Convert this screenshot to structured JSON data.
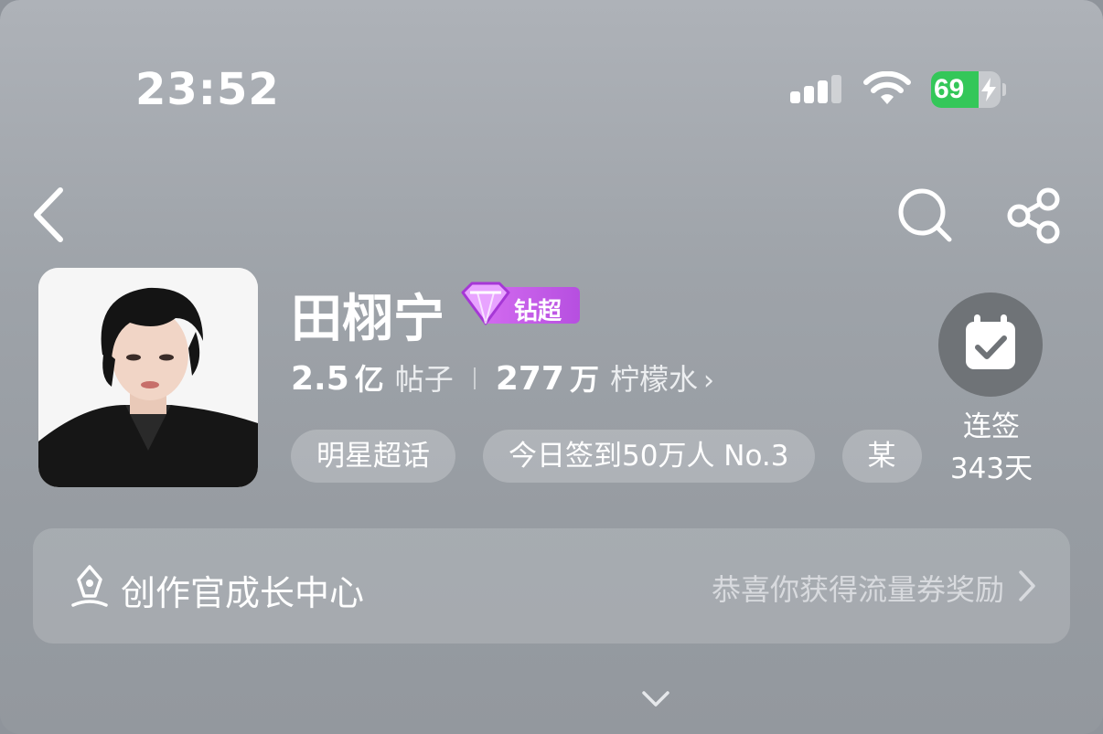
{
  "status_bar": {
    "time": "23:52",
    "battery_percent": "69",
    "battery_level": 0.69,
    "signal_icon": "cellular-signal-icon",
    "wifi_icon": "wifi-icon",
    "battery_icon": "battery-charging-icon"
  },
  "nav": {
    "back_icon": "chevron-left-icon",
    "search_icon": "search-icon",
    "share_icon": "share-icon"
  },
  "profile": {
    "name": "田栩宁",
    "badge_label": "钻超",
    "badge_level": "3",
    "avatar_icon": "avatar-photo"
  },
  "stats": {
    "posts_value": "2.5",
    "posts_unit": "亿",
    "posts_label": "帖子",
    "fans_value": "277",
    "fans_unit": "万",
    "fans_label": "柠檬水",
    "chevron": "›"
  },
  "tags": [
    {
      "label": "明星超话"
    },
    {
      "label": "今日签到50万人 No.3"
    },
    {
      "label": "某"
    }
  ],
  "checkin": {
    "icon": "calendar-check-icon",
    "line1": "连签",
    "line2": "343天"
  },
  "creator_center": {
    "icon": "pen-icon",
    "title": "创作官成长中心",
    "subtitle": "恭喜你获得流量券奖励",
    "chevron_icon": "chevron-right-icon"
  },
  "expand_icon": "chevron-down-icon",
  "colors": {
    "battery_green": "#34c759",
    "badge_purple": "#c25be8"
  }
}
